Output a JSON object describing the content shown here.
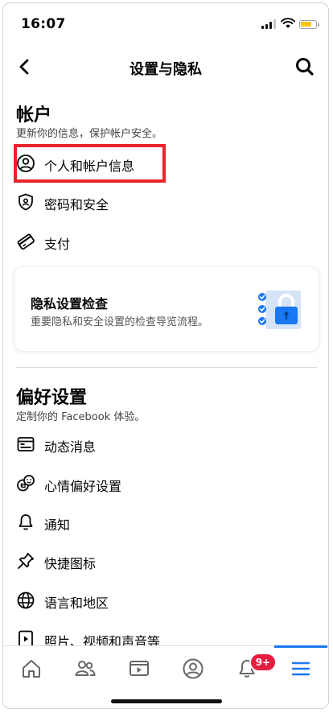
{
  "status_bar": {
    "time": "16:07"
  },
  "header": {
    "title": "设置与隐私",
    "back_icon": "chevron-left-icon",
    "search_icon": "search-icon"
  },
  "account": {
    "title": "帐户",
    "subtitle": "更新你的信息，保护帐户安全。",
    "items": [
      {
        "label": "个人和帐户信息",
        "icon": "person-circle-icon"
      },
      {
        "label": "密码和安全",
        "icon": "shield-icon"
      },
      {
        "label": "支付",
        "icon": "credit-card-icon"
      }
    ]
  },
  "privacy_card": {
    "title": "隐私设置检查",
    "subtitle": "重要隐私和安全设置的检查导览流程。",
    "icon": "lock-checklist-icon"
  },
  "preferences": {
    "title": "偏好设置",
    "subtitle": "定制你的 Facebook 体验。",
    "items": [
      {
        "label": "动态消息",
        "icon": "news-feed-icon"
      },
      {
        "label": "心情偏好设置",
        "icon": "reactions-icon"
      },
      {
        "label": "通知",
        "icon": "bell-icon"
      },
      {
        "label": "快捷图标",
        "icon": "pin-icon"
      },
      {
        "label": "语言和地区",
        "icon": "globe-icon"
      },
      {
        "label": "照片、视频和声音等",
        "icon": "media-icon"
      }
    ]
  },
  "tab_bar": {
    "tabs": [
      {
        "name": "home",
        "icon": "home-icon"
      },
      {
        "name": "friends",
        "icon": "friends-icon"
      },
      {
        "name": "watch",
        "icon": "video-icon"
      },
      {
        "name": "profile",
        "icon": "profile-icon"
      },
      {
        "name": "notifications",
        "icon": "bell-icon",
        "badge": "9+"
      },
      {
        "name": "menu",
        "icon": "menu-icon",
        "active": true
      }
    ]
  },
  "colors": {
    "accent": "#1877F2",
    "highlight_box": "#E8242A",
    "badge": "#E41E3F"
  }
}
